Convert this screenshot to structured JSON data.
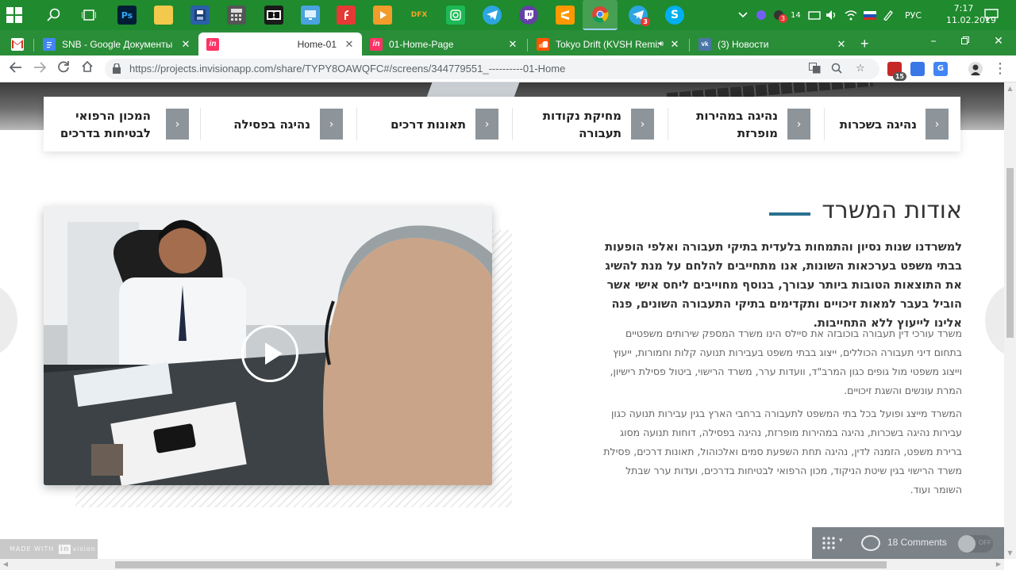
{
  "taskbar": {
    "apps": [
      {
        "icon": "search-icon",
        "label": ""
      },
      {
        "icon": "task-view-icon",
        "label": ""
      },
      {
        "icon": "photoshop-icon",
        "label": "Ps"
      },
      {
        "icon": "file-explorer-icon",
        "label": ""
      },
      {
        "icon": "save-floppy-icon",
        "label": ""
      },
      {
        "icon": "calculator-icon",
        "label": ""
      },
      {
        "icon": "dolby-icon",
        "label": ""
      },
      {
        "icon": "monitor-icon",
        "label": ""
      },
      {
        "icon": "flash-icon",
        "label": ""
      },
      {
        "icon": "media-player-icon",
        "label": ""
      },
      {
        "icon": "dfx-icon",
        "label": "DFX"
      },
      {
        "icon": "instagram-icon",
        "label": ""
      },
      {
        "icon": "telegram-icon",
        "label": ""
      },
      {
        "icon": "twitch-icon",
        "label": ""
      },
      {
        "icon": "sublime-icon",
        "label": ""
      },
      {
        "icon": "chrome-icon",
        "label": ""
      },
      {
        "icon": "telegram-icon",
        "label": ""
      },
      {
        "icon": "skype-icon",
        "label": ""
      }
    ],
    "telegram_badge": "3",
    "tray_badge": "3",
    "tray_num": "14",
    "language": "РУС",
    "time": "7:17",
    "date": "11.02.2019"
  },
  "browser": {
    "tabs": [
      {
        "title": "",
        "favicon": "gmail-icon",
        "color": "#c62828"
      },
      {
        "title": "SNB - Google Документы",
        "favicon": "docs-icon",
        "color": "#4285f4"
      },
      {
        "title": "Home-01",
        "favicon": "invision-icon",
        "color": "#ff3366",
        "active": true
      },
      {
        "title": "01-Home-Page",
        "favicon": "invision-icon",
        "color": "#ff3366"
      },
      {
        "title": "Tokyo Drift (KVSH Remix)",
        "favicon": "soundcloud-icon",
        "color": "#ff5500"
      },
      {
        "title": "(3) Новости",
        "favicon": "vk-icon",
        "color": "#4a76a8"
      }
    ],
    "new_tab": "+",
    "url": "https://projects.invisionapp.com/share/TYPY8OAWQFC#/screens/344779551_----------01-Home",
    "ext_badge": "15"
  },
  "page": {
    "categories": [
      {
        "label": "נהיגה בשכרות"
      },
      {
        "label": "נהיגה במהירות מופרזת"
      },
      {
        "label": "מחיקת נקודות תעבורה"
      },
      {
        "label": "תאונות דרכים"
      },
      {
        "label": "נהיגה בפסילה"
      },
      {
        "label": "המכון הרפואי לבטיחות בדרכים"
      }
    ],
    "about_title": "אודות המשרד",
    "lead": "למשרדנו שנות נסיון והתמחות בלעדית בתיקי תעבורה ואלפי הופעות בבתי משפט בערכאות השונות, אנו מתחייבים להלחם על מנת להשיג את התוצאות הטובות ביותר עבורך, בנוסף מחוייבים ליחס אישי אשר הוביל בעבר למאות זיכויים ותקדימים בתיקי התעבורה השונים, פנה אלינו לייעוץ ללא התחייבות.",
    "body1": "משרד עורכי דין תעבורה בוכובזה את סיילס הינו משרד המספק שירותים משפטיים בתחום דיני תעבורה הכוללים, ייצוג בבתי משפט בעבירות תנועה קלות וחמורות, ייעוץ וייצוג משפטי מול גופים כגון המרב\"ד, וועדות ערר, משרד הרישוי, ביטול פסילת רישיון, המרת עונשים והשגת זיכויים.",
    "body2": "המשרד מייצג ופועל בכל בתי המשפט לתעבורה ברחבי הארץ בגין עבירות תנועה כגון עבירות נהיגה בשכרות, נהיגה במהירות מופרזת, נהיגה בפסילה, דוחות תנועה מסוג ברירת משפט, הזמנה לדין, נהיגה תחת השפעת סמים ואלכוהול, תאונות דרכים, פסילת משרד הרישוי בגין שיטת הניקוד, מכון הרפואי לבטיחות בדרכים, ועדות ערר שבתל השומר ועוד."
  },
  "invision": {
    "made_with_prefix": "MADE WITH",
    "made_with_brand": "in",
    "made_with_suffix": "vision",
    "comments": "18 Comments",
    "toggle_state": "OFF"
  }
}
